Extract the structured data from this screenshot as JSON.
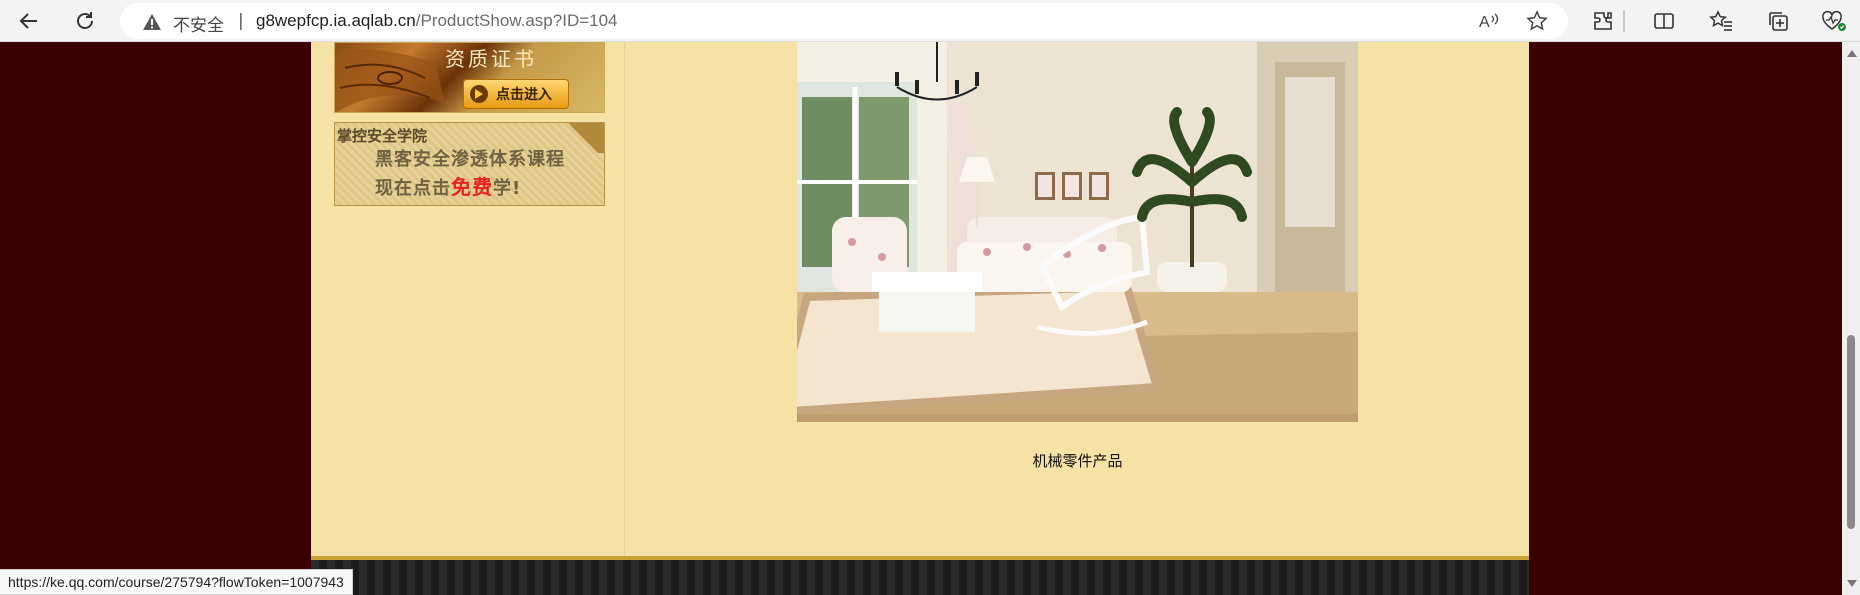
{
  "browser": {
    "security_label": "不安全",
    "separator": "|",
    "url_host": "g8wepfcp.ia.aqlab.cn",
    "url_path": "/ProductShow.asp?ID=104"
  },
  "sidebar": {
    "cert_banner": {
      "title": "资质证书",
      "button_label": "点击进入"
    },
    "academy_banner": {
      "title": "掌控安全学院",
      "line1": "黑客安全渗透体系课程",
      "line2_prefix": "现在点击",
      "line2_highlight": "免费",
      "line2_suffix": "学!"
    }
  },
  "product": {
    "caption": "机械零件产品"
  },
  "status_bar": {
    "url": "https://ke.qq.com/course/275794?flowToken=1007943"
  },
  "colors": {
    "page_bg": "#3a0202",
    "content_bg": "#f5e2a4",
    "free_highlight": "#e6211e"
  },
  "icons": [
    "back-icon",
    "refresh-icon",
    "warning-icon",
    "read-aloud-icon",
    "favorite-star-icon",
    "extensions-icon",
    "split-screen-icon",
    "favorites-icon",
    "collections-icon",
    "browser-essentials-icon"
  ]
}
